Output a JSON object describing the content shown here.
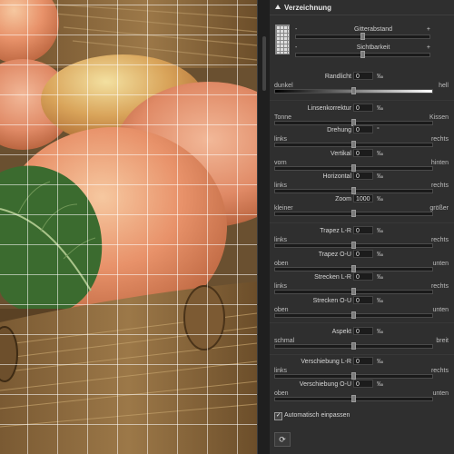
{
  "panel": {
    "title": "Verzeichnung",
    "grid_spacing_label": "Gitterabstand",
    "visibility_label": "Sichtbarkeit",
    "minus": "-",
    "plus": "+",
    "auto_fit_label": "Automatisch einpassen",
    "auto_fit_checked": true,
    "reset_icon": "refresh-icon"
  },
  "controls": [
    {
      "left": "dunkel",
      "name": "Randlicht",
      "value": "0",
      "unit": "‰",
      "right": "hell",
      "slider": 0.5,
      "gradient": true
    },
    {
      "left": "Tonne",
      "name": "Linsenkorrektur",
      "value": "0",
      "unit": "‰",
      "right": "Kissen",
      "slider": 0.5
    },
    {
      "left": "links",
      "name": "Drehung",
      "value": "0",
      "unit": "°",
      "right": "rechts",
      "slider": 0.5
    },
    {
      "left": "vorn",
      "name": "Vertikal",
      "value": "0",
      "unit": "‰",
      "right": "hinten",
      "slider": 0.5
    },
    {
      "left": "links",
      "name": "Horizontal",
      "value": "0",
      "unit": "‰",
      "right": "rechts",
      "slider": 0.5
    },
    {
      "left": "kleiner",
      "name": "Zoom",
      "value": "1000",
      "unit": "‰",
      "right": "größer",
      "slider": 0.5
    },
    {
      "left": "links",
      "name": "Trapez L-R",
      "value": "0",
      "unit": "‰",
      "right": "rechts",
      "slider": 0.5
    },
    {
      "left": "oben",
      "name": "Trapez O-U",
      "value": "0",
      "unit": "‰",
      "right": "unten",
      "slider": 0.5
    },
    {
      "left": "links",
      "name": "Strecken L-R",
      "value": "0",
      "unit": "‰",
      "right": "rechts",
      "slider": 0.5
    },
    {
      "left": "oben",
      "name": "Strecken O-U",
      "value": "0",
      "unit": "‰",
      "right": "unten",
      "slider": 0.5
    },
    {
      "left": "schmal",
      "name": "Aspekt",
      "value": "0",
      "unit": "‰",
      "right": "breit",
      "slider": 0.5
    },
    {
      "left": "links",
      "name": "Verschiebung L-R",
      "value": "0",
      "unit": "‰",
      "right": "rechts",
      "slider": 0.5
    },
    {
      "left": "oben",
      "name": "Verschiebung O-U",
      "value": "0",
      "unit": "‰",
      "right": "unten",
      "slider": 0.5
    }
  ]
}
